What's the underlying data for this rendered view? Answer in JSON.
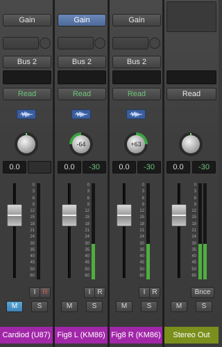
{
  "strips": [
    {
      "gain_label": "Gain",
      "bus_label": "Bus 2",
      "read_label": "Read",
      "pan_value": "",
      "volume_value": "0.0",
      "peak_value": "",
      "name": "Cardiod (U87)",
      "input_label": "I",
      "record_label": "R",
      "mute_label": "M",
      "solo_label": "S",
      "meter_level": 0.0
    },
    {
      "gain_label": "Gain",
      "bus_label": "Bus 2",
      "read_label": "Read",
      "pan_value": "-64",
      "volume_value": "0.0",
      "peak_value": "-30",
      "name": "Fig8 L (KM86)",
      "input_label": "I",
      "record_label": "R",
      "mute_label": "M",
      "solo_label": "S",
      "meter_level": 0.37
    },
    {
      "gain_label": "Gain",
      "bus_label": "Bus 2",
      "read_label": "Read",
      "pan_value": "+63",
      "volume_value": "0.0",
      "peak_value": "-30",
      "name": "Fig8 R (KM86)",
      "input_label": "I",
      "record_label": "R",
      "mute_label": "M",
      "solo_label": "S",
      "meter_level": 0.37
    },
    {
      "read_label": "Read",
      "volume_value": "0.0",
      "peak_value": "-30",
      "name": "Stereo Out",
      "bounce_label": "Bnce",
      "mute_label": "M",
      "solo_label": "S",
      "meter_level": 0.37
    }
  ],
  "scale_ticks": [
    "0",
    "3",
    "6",
    "9",
    "12",
    "15",
    "18",
    "21",
    "24",
    "30",
    "35",
    "40",
    "45",
    "50",
    "60"
  ],
  "colors": {
    "read_green": "#6ec47a",
    "track_purple": "#a127a8",
    "output_olive": "#7a8f1c",
    "active_blue": "#5ba7d6",
    "gain_selected": "#5b7aab"
  },
  "icons": {
    "stereo_link": "waveform-icon",
    "pan_knob": "pan-knob"
  }
}
